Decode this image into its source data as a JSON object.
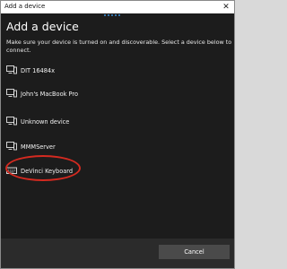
{
  "window": {
    "title": "Add a device",
    "close_glyph": "✕"
  },
  "dialog": {
    "heading": "Add a device",
    "description": "Make sure your device is turned on and discoverable. Select a device below to connect."
  },
  "devices": [
    {
      "label": "DIT 16484x",
      "icon": "computer-monitor-icon"
    },
    {
      "label": "John's MacBook Pro",
      "icon": "computer-monitor-icon"
    },
    {
      "label": "Unknown device",
      "icon": "computer-monitor-icon"
    },
    {
      "label": "MMMServer",
      "icon": "computer-monitor-icon"
    },
    {
      "label": "DeVinci Keyboard",
      "icon": "keyboard-icon"
    }
  ],
  "footer": {
    "cancel_label": "Cancel"
  },
  "colors": {
    "background": "#1c1c1c",
    "titlebar": "#ffffff",
    "accent": "#3a8fd9",
    "highlight": "#d42a20",
    "button": "#4a4a4a"
  }
}
